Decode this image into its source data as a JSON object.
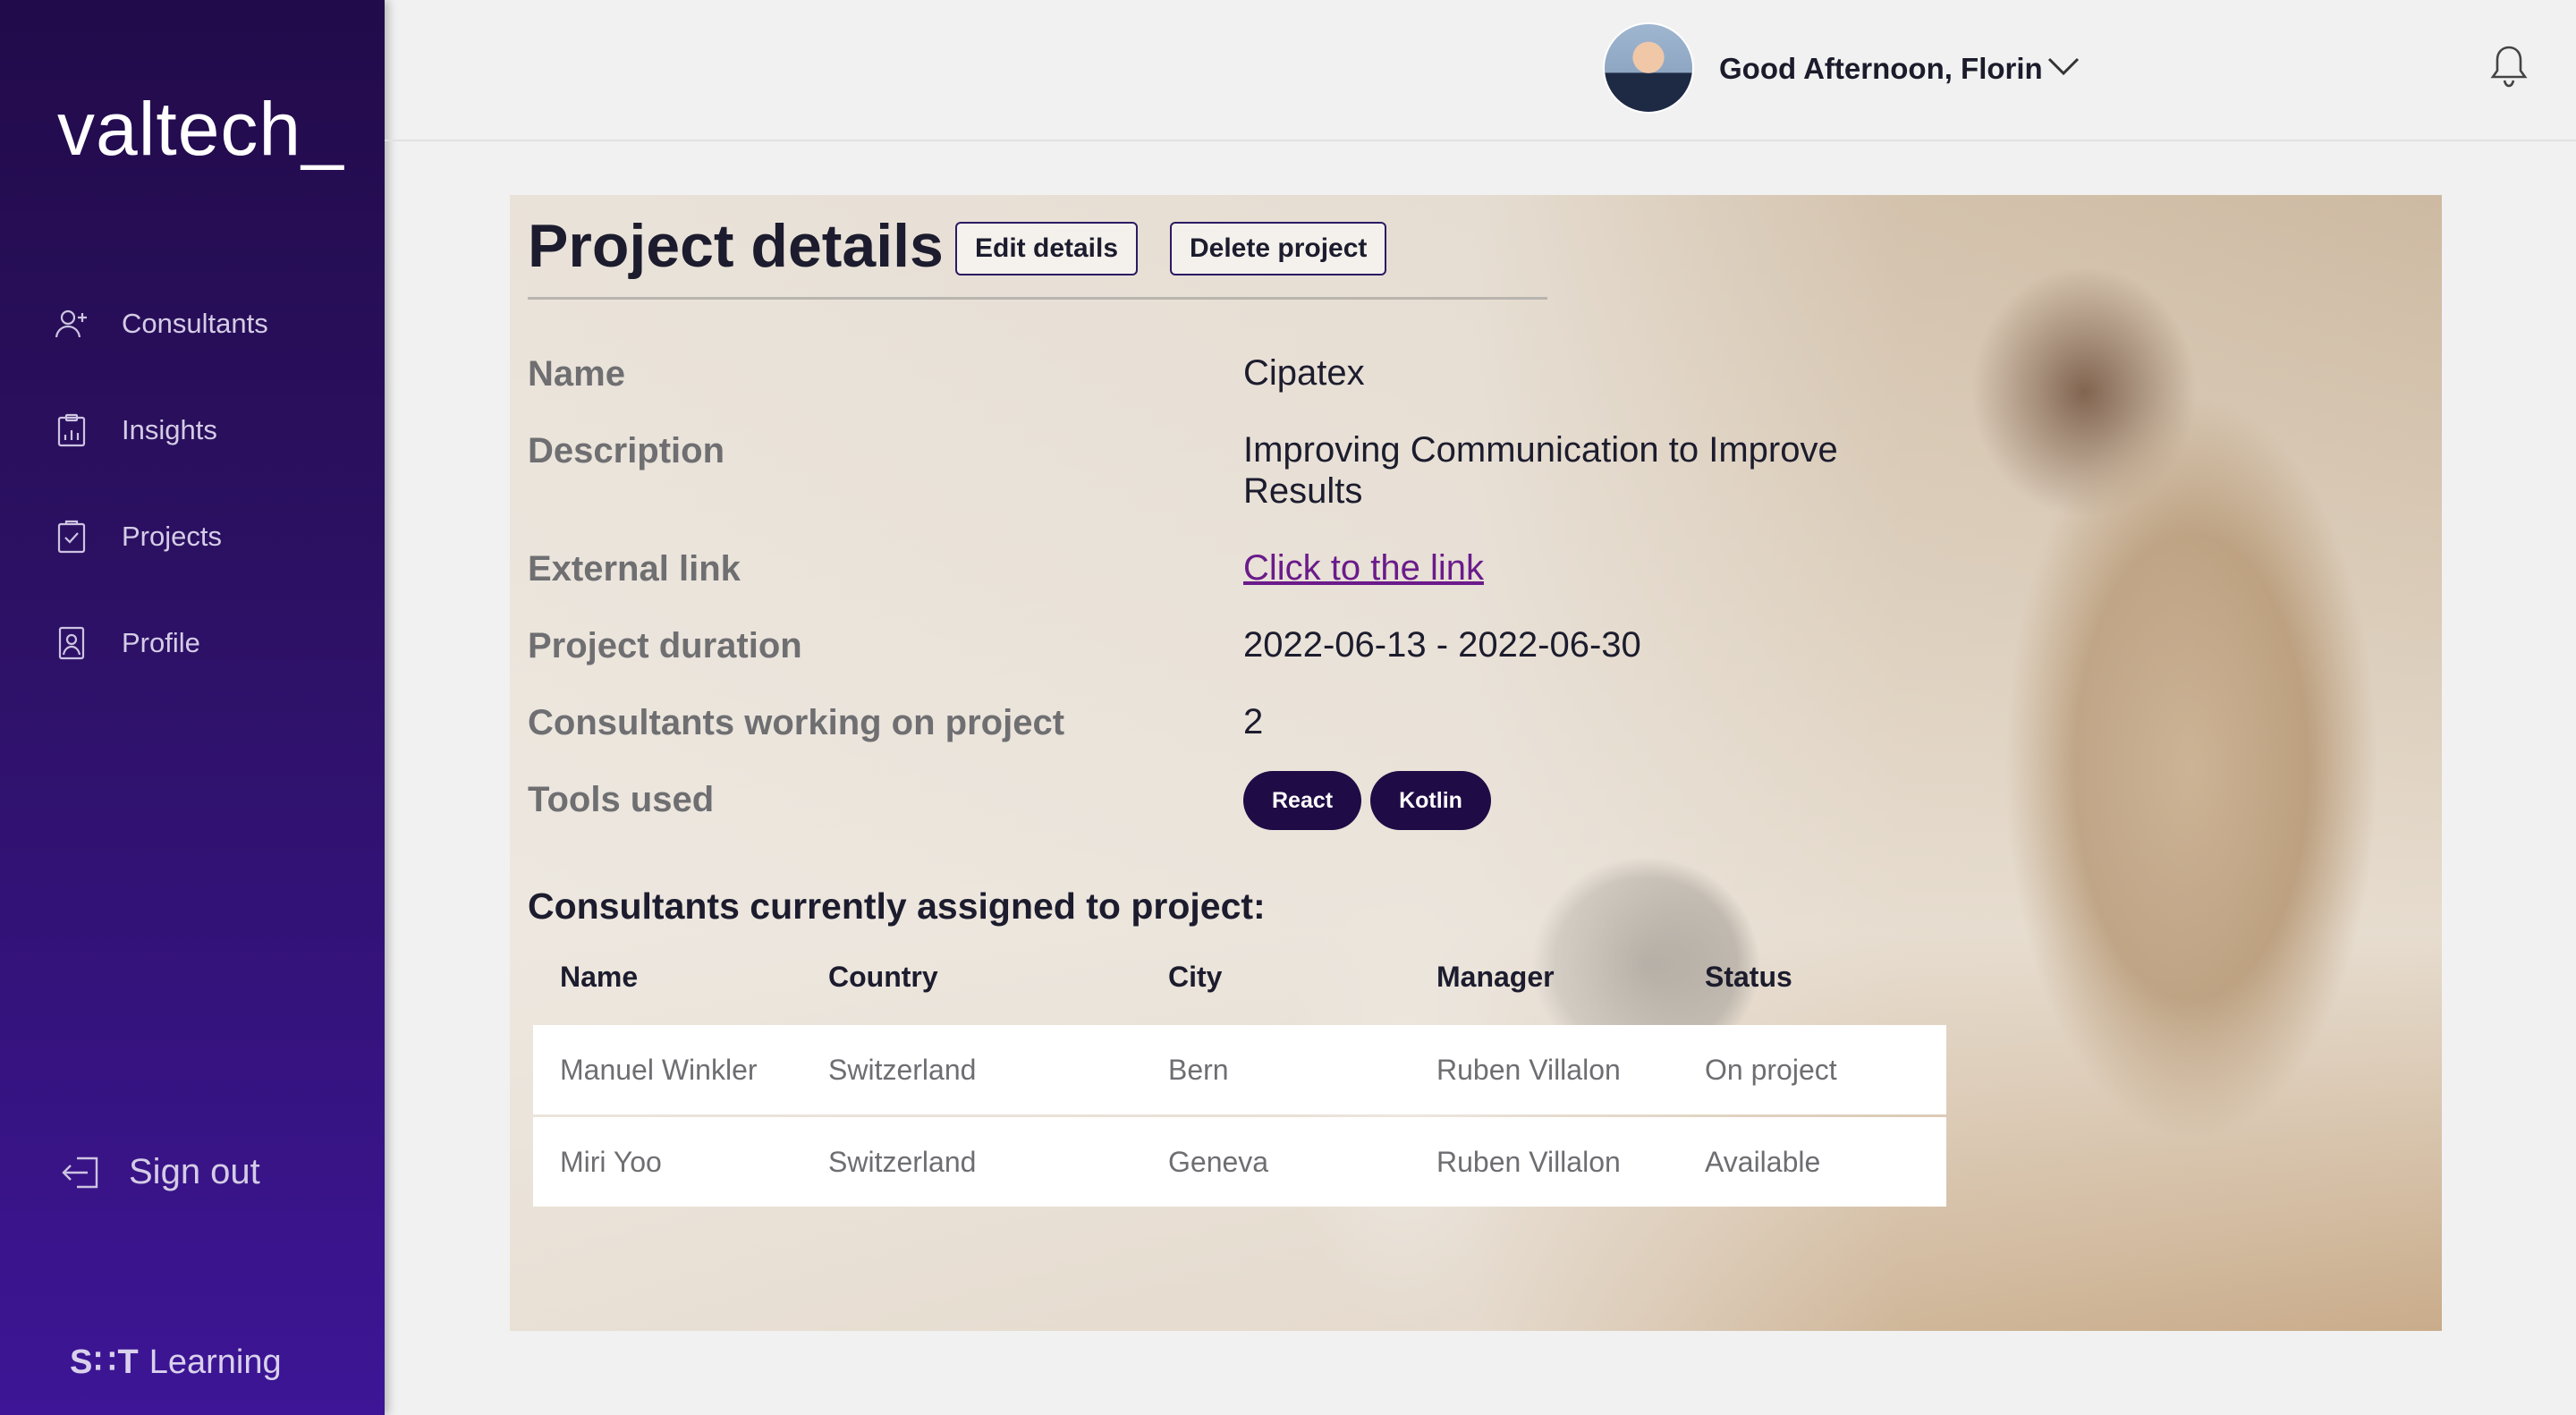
{
  "sidebar": {
    "logo": "valtech_",
    "items": [
      {
        "label": "Consultants",
        "icon": "add-user-icon"
      },
      {
        "label": "Insights",
        "icon": "clipboard-chart-icon"
      },
      {
        "label": "Projects",
        "icon": "clipboard-check-icon"
      },
      {
        "label": "Profile",
        "icon": "id-badge-icon"
      }
    ],
    "signout_label": "Sign out",
    "footer_brand": "S∷T",
    "footer_text": "Learning"
  },
  "header": {
    "greeting": "Good Afternoon, Florin"
  },
  "page": {
    "title": "Project details",
    "edit_button": "Edit details",
    "delete_button": "Delete project"
  },
  "details": {
    "name_label": "Name",
    "name_value": "Cipatex",
    "description_label": "Description",
    "description_value": "Improving Communication to Improve Results",
    "link_label": "External link",
    "link_value": "Click to the link",
    "duration_label": "Project duration",
    "duration_value": "2022-06-13 - 2022-06-30",
    "consultants_label": "Consultants working on project",
    "consultants_value": "2",
    "tools_label": "Tools used",
    "tools": [
      "React",
      "Kotlin"
    ]
  },
  "assigned": {
    "title": "Consultants currently assigned to project:",
    "columns": [
      "Name",
      "Country",
      "City",
      "Manager",
      "Status"
    ],
    "rows": [
      [
        "Manuel Winkler",
        "Switzerland",
        "Bern",
        "Ruben Villalon",
        "On project"
      ],
      [
        "Miri Yoo",
        "Switzerland",
        "Geneva",
        "Ruben Villalon",
        "Available"
      ]
    ]
  },
  "colors": {
    "sidebar": "#2d1166",
    "chip": "#1f0b45",
    "link": "#6a1b8a"
  }
}
